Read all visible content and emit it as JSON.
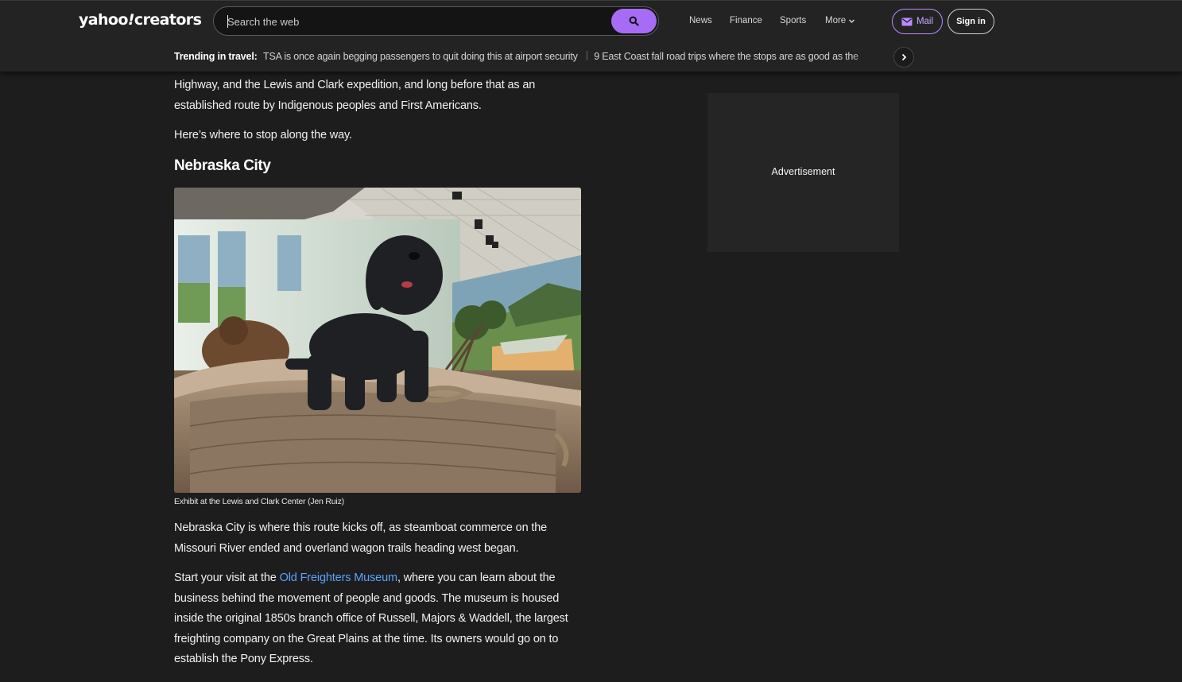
{
  "header": {
    "logo_text": "yahoo!creators",
    "logo_primary": "yahoo",
    "logo_slash": "!",
    "logo_secondary": "creators",
    "search_placeholder": "Search the web",
    "nav": [
      "News",
      "Finance",
      "Sports",
      "More"
    ],
    "mail_label": "Mail",
    "signin_label": "Sign in"
  },
  "trending": {
    "label": "Trending in travel:",
    "items": [
      "TSA is once again begging passengers to quit doing this at airport security",
      "9 East Coast fall road trips where the stops are as good as the"
    ]
  },
  "article": {
    "intro_lines": [
      "Highway, and the Lewis and Clark expedition, and long before that as an",
      "established route by Indigenous peoples and First Americans."
    ],
    "lead_out": "Here’s where to stop along the way.",
    "section_heading": "Nebraska City",
    "image_caption": "Exhibit at the Lewis and Clark Center (Jen Ruiz)",
    "para1": "Nebraska City is where this route kicks off, as steamboat commerce on the Missouri River ended and overland wagon trails heading west began.",
    "para2_prefix": "Start your visit at the ",
    "para2_link": "Old Freighters Museum",
    "para2_rest": ", where you can learn about the business behind the movement of people and goods. The museum is housed inside the original 1850s branch office of Russell, Majors & Waddell, the largest freighting company on the Great Plains at the time. Its owners would go on to establish the Pony Express."
  },
  "sidebar": {
    "ad_label": "Advertisement"
  },
  "colors": {
    "page_bg": "#1d1d1d",
    "header_bg": "#232323",
    "accent_purple": "#a76cf5",
    "mail_purple": "#c9a4ff",
    "link_blue": "#5aa3ff"
  },
  "icons": [
    "search-icon",
    "chevron-down-icon",
    "mail-icon",
    "chevron-right-icon"
  ]
}
